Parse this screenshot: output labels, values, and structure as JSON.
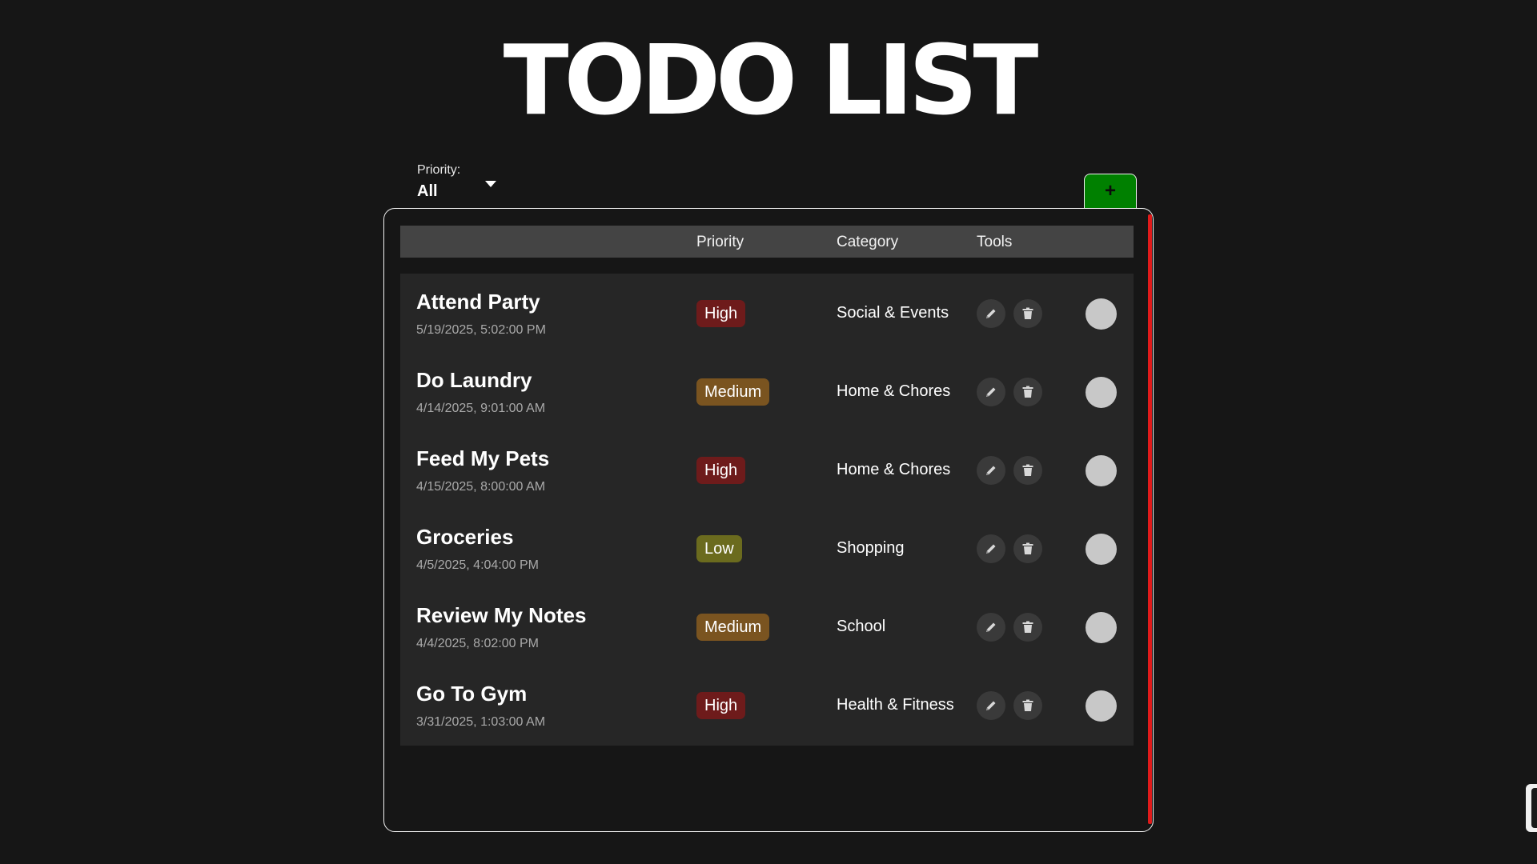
{
  "app": {
    "title": "TODO LIST"
  },
  "filter": {
    "caption": "Priority:",
    "value": "All",
    "icon": "caret-down-icon"
  },
  "toolbar": {
    "add_label": "+"
  },
  "table": {
    "columns": {
      "priority": "Priority",
      "category": "Category",
      "tools": "Tools"
    }
  },
  "priority_colors": {
    "High": "#6e1b1b",
    "Medium": "#7a5420",
    "Low": "#6b6b1e"
  },
  "tasks": [
    {
      "title": "Attend Party",
      "date": "5/19/2025, 5:02:00 PM",
      "priority": "High",
      "category": "Social & Events"
    },
    {
      "title": "Do Laundry",
      "date": "4/14/2025, 9:01:00 AM",
      "priority": "Medium",
      "category": "Home & Chores"
    },
    {
      "title": "Feed My Pets",
      "date": "4/15/2025, 8:00:00 AM",
      "priority": "High",
      "category": "Home & Chores"
    },
    {
      "title": "Groceries",
      "date": "4/5/2025, 4:04:00 PM",
      "priority": "Low",
      "category": "Shopping"
    },
    {
      "title": "Review My Notes",
      "date": "4/4/2025, 8:02:00 PM",
      "priority": "Medium",
      "category": "School"
    },
    {
      "title": "Go To Gym",
      "date": "3/31/2025, 1:03:00 AM",
      "priority": "High",
      "category": "Health & Fitness"
    }
  ],
  "colors": {
    "accent_add": "#008000",
    "scroll_accent": "#e01b1b",
    "background": "#161616"
  }
}
